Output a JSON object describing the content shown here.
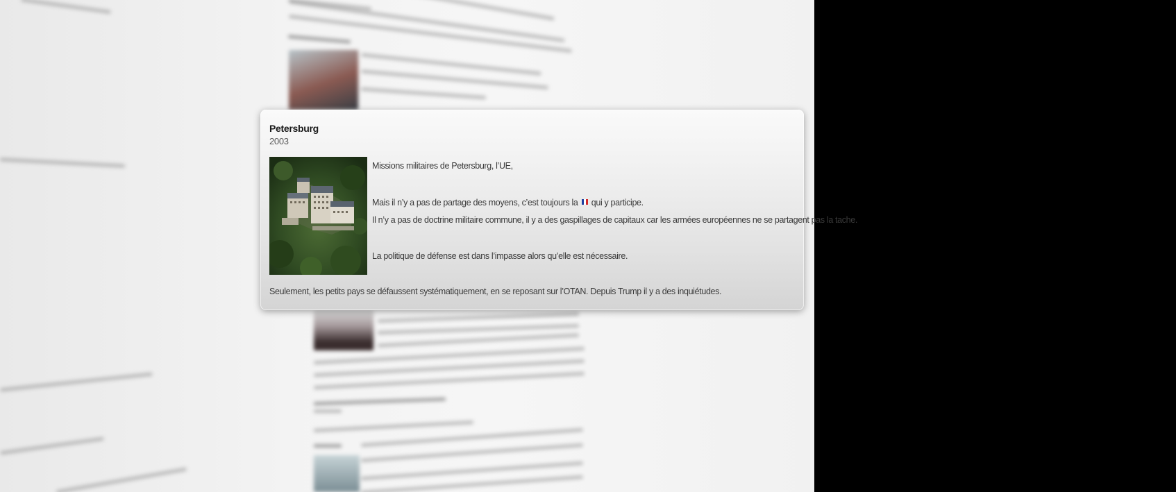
{
  "card": {
    "title": "Petersburg",
    "year": "2003",
    "image_alt": "aerial view of hotel Petersberg",
    "paragraphs": {
      "p1": "Missions militaires  de Petersburg, l’UE,",
      "p2_before_flag": "Mais il n’y a pas de partage des moyens, c’est toujours la",
      "p2_flag": "french-flag",
      "p2_after_flag": "qui y participe.",
      "p3": "Il n’y a pas de doctrine militaire commune, il y a des gaspillages de capitaux car les armées européennes ne se partagent pas la tache.",
      "p4": "La politique de défense est dans l’impasse alors qu’elle est nécessaire."
    },
    "footer": "Seulement, les petits pays se défaussent systématiquement, en se reposant sur l’OTAN. Depuis Trump il y a des inquiétudes."
  },
  "colors": {
    "background": "#f2f2f2",
    "right_pane": "#000000",
    "flag": [
      "#1f3fa0",
      "#ffffff",
      "#d42a2a"
    ]
  }
}
